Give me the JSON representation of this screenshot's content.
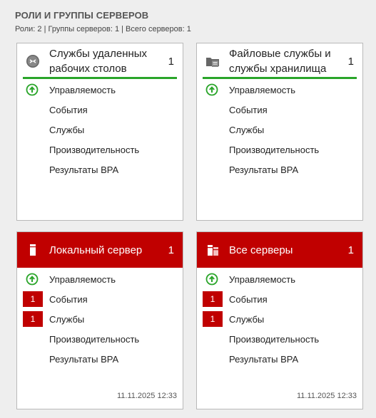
{
  "header": {
    "title": "РОЛИ И ГРУППЫ СЕРВЕРОВ",
    "subtitle": "Роли: 2 | Группы серверов: 1 | Всего серверов: 1"
  },
  "tiles": [
    {
      "title_line1": "Службы удаленных",
      "title_line2": "рабочих столов",
      "count": "1",
      "icon": "remote-desktop-icon",
      "rows": [
        "Управляемость",
        "События",
        "Службы",
        "Производительность",
        "Результаты BPA"
      ]
    },
    {
      "title_line1": "Файловые службы и",
      "title_line2": "службы хранилища",
      "count": "1",
      "icon": "file-services-icon",
      "rows": [
        "Управляемость",
        "События",
        "Службы",
        "Производительность",
        "Результаты BPA"
      ]
    },
    {
      "title": "Локальный сервер",
      "count": "1",
      "icon": "server-icon",
      "rows": [
        "Управляемость",
        "События",
        "Службы",
        "Производительность",
        "Результаты BPA"
      ],
      "badges": {
        "events": "1",
        "services": "1"
      },
      "timestamp": "11.11.2025 12:33"
    },
    {
      "title": "Все серверы",
      "count": "1",
      "icon": "servers-icon",
      "rows": [
        "Управляемость",
        "События",
        "Службы",
        "Производительность",
        "Результаты BPA"
      ],
      "badges": {
        "events": "1",
        "services": "1"
      },
      "timestamp": "11.11.2025 12:33"
    }
  ],
  "colors": {
    "alert": "#c00000",
    "ok": "#2aa52a"
  }
}
